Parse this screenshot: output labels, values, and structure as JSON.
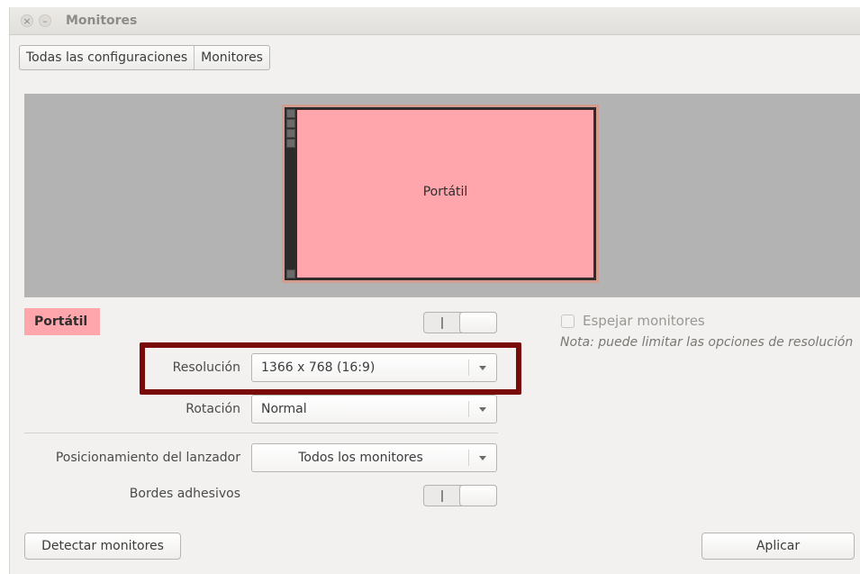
{
  "window": {
    "title": "Monitores",
    "close_glyph": "×",
    "minimize_glyph": "–"
  },
  "breadcrumb": {
    "items": [
      {
        "label": "Todas las configuraciones"
      },
      {
        "label": "Monitores"
      }
    ]
  },
  "display": {
    "name": "Portátil",
    "color": "#ffa6ac"
  },
  "panel": {
    "tag": "Portátil",
    "mirror_label": "Espejar monitores",
    "mirror_checked": false,
    "note": "Nota: puede limitar las opciones de resolución",
    "resolution_label": "Resolución",
    "resolution_value": "1366 x 768 (16:9)",
    "rotation_label": "Rotación",
    "rotation_value": "Normal",
    "launcher_label": "Posicionamiento del lanzador",
    "launcher_value": "Todos los monitores",
    "sticky_label": "Bordes adhesivos",
    "switch_glyph": "I"
  },
  "buttons": {
    "detect": "Detectar monitores",
    "apply": "Aplicar"
  },
  "colors": {
    "highlight": "#7a0a0a",
    "display_border": "#d49b8f"
  }
}
